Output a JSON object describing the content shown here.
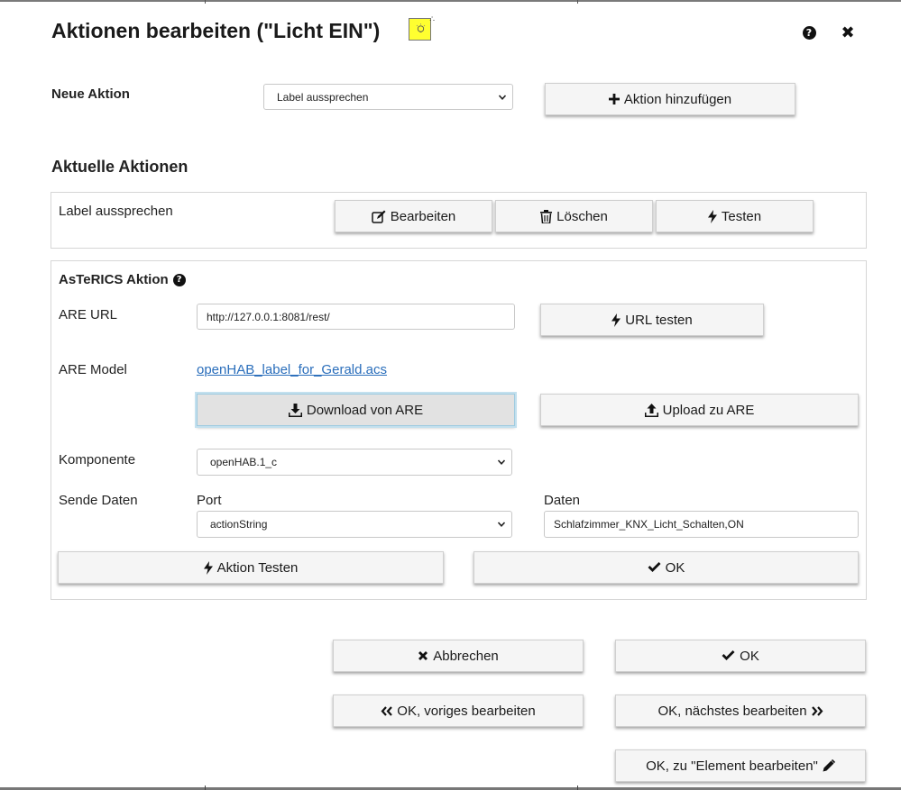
{
  "dialog": {
    "title": "Aktionen bearbeiten (\"Licht EIN\")",
    "help_icon": "question-circle-icon",
    "close_icon": "close-icon"
  },
  "new_action": {
    "label": "Neue Aktion",
    "selected_option": "Label aussprechen",
    "add_button": "Aktion hinzufügen"
  },
  "current_actions": {
    "heading": "Aktuelle Aktionen",
    "items": [
      {
        "label": "Label aussprechen",
        "edit": "Bearbeiten",
        "delete": "Löschen",
        "test": "Testen"
      }
    ]
  },
  "asterics": {
    "heading": "AsTeRICS Aktion",
    "are_url_label": "ARE URL",
    "are_url_value": "http://127.0.0.1:8081/rest/",
    "url_test_button": "URL testen",
    "are_model_label": "ARE Model",
    "are_model_link": "openHAB_label_for_Gerald.acs",
    "download_button": "Download von ARE",
    "upload_button": "Upload zu ARE",
    "component_label": "Komponente",
    "component_value": "openHAB.1_c",
    "send_data_label": "Sende Daten",
    "port_label": "Port",
    "port_value": "actionString",
    "data_label": "Daten",
    "data_value": "Schlafzimmer_KNX_Licht_Schalten,ON",
    "test_action_button": "Aktion Testen",
    "ok_button": "OK"
  },
  "footer": {
    "cancel": "Abbrechen",
    "ok": "OK",
    "ok_prev": "OK, voriges bearbeiten",
    "ok_next": "OK, nächstes bearbeiten",
    "ok_element": "OK, zu \"Element bearbeiten\""
  },
  "colors": {
    "button_bg": "#f5f5f5",
    "link": "#2a6ebb",
    "title_image_bg": "#ffff30",
    "focus_ring": "#9ecbe0"
  }
}
